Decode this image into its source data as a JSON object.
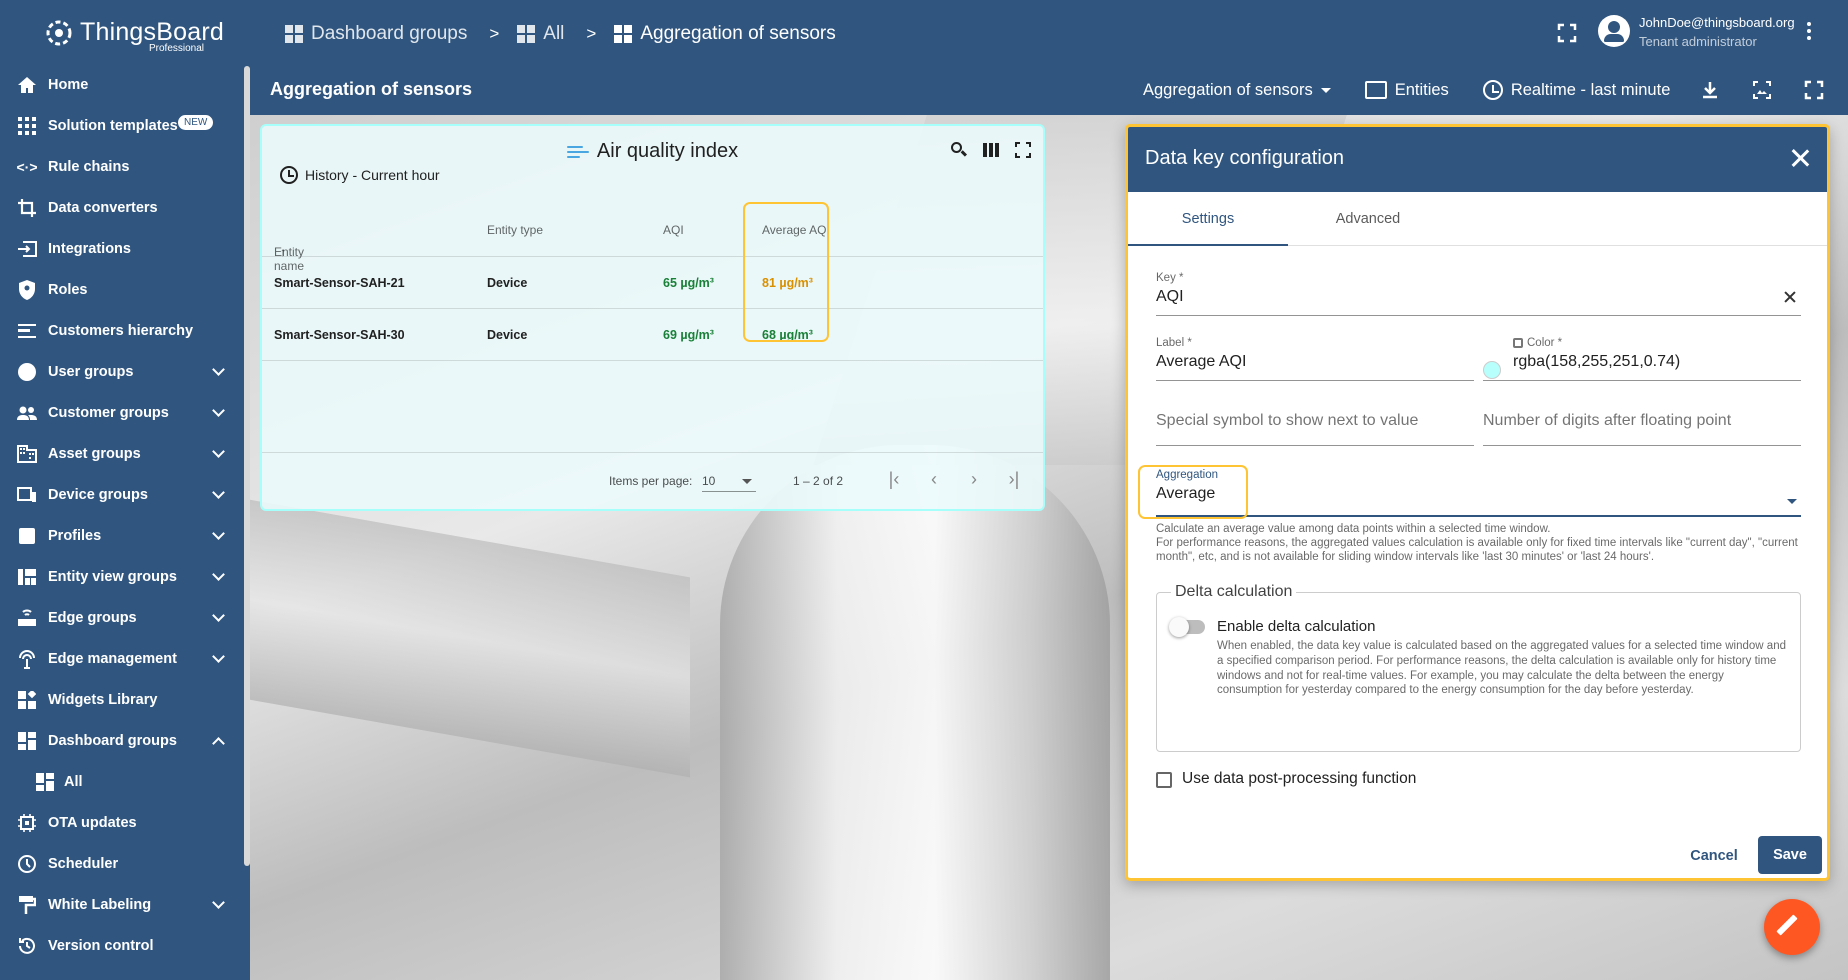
{
  "brand": {
    "name": "ThingsBoard",
    "edition": "Professional"
  },
  "breadcrumb": [
    {
      "label": "Dashboard groups"
    },
    {
      "label": "All"
    },
    {
      "label": "Aggregation of sensors"
    }
  ],
  "breadcrumb_sep": ">",
  "user": {
    "email": "JohnDoe@thingsboard.org",
    "role": "Tenant administrator"
  },
  "dashboard": {
    "title": "Aggregation of sensors",
    "state_selector": "Aggregation of sensors",
    "entities_label": "Entities",
    "timewindow": "Realtime - last minute"
  },
  "sidebar": {
    "items": [
      {
        "label": "Home",
        "icon": "home-icon"
      },
      {
        "label": "Solution templates",
        "icon": "apps-icon",
        "badge": "NEW"
      },
      {
        "label": "Rule chains",
        "icon": "code-arrows-icon"
      },
      {
        "label": "Data converters",
        "icon": "crop-icon"
      },
      {
        "label": "Integrations",
        "icon": "input-icon"
      },
      {
        "label": "Roles",
        "icon": "shield-icon"
      },
      {
        "label": "Customers hierarchy",
        "icon": "sort-lines-icon"
      },
      {
        "label": "User groups",
        "icon": "account-icon",
        "expandable": true
      },
      {
        "label": "Customer groups",
        "icon": "people-icon",
        "expandable": true
      },
      {
        "label": "Asset groups",
        "icon": "domain-icon",
        "expandable": true
      },
      {
        "label": "Device groups",
        "icon": "devices-icon",
        "expandable": true
      },
      {
        "label": "Profiles",
        "icon": "badge-icon",
        "expandable": true
      },
      {
        "label": "Entity view groups",
        "icon": "view-quilt-icon",
        "expandable": true
      },
      {
        "label": "Edge groups",
        "icon": "router-icon",
        "expandable": true
      },
      {
        "label": "Edge management",
        "icon": "settings-input-antenna-icon",
        "expandable": true
      },
      {
        "label": "Widgets Library",
        "icon": "widgets-icon"
      },
      {
        "label": "Dashboard groups",
        "icon": "dashboards-icon",
        "expandable": true,
        "expanded": true
      },
      {
        "label": "All",
        "icon": "dashboards-icon",
        "sub": true
      },
      {
        "label": "OTA updates",
        "icon": "memory-icon"
      },
      {
        "label": "Scheduler",
        "icon": "clock-icon"
      },
      {
        "label": "White Labeling",
        "icon": "format-paint-icon",
        "expandable": true
      },
      {
        "label": "Version control",
        "icon": "history-icon"
      }
    ]
  },
  "widget": {
    "title": "Air quality index",
    "history": "History - Current hour",
    "columns": [
      "Entity name",
      "Entity type",
      "AQI",
      "Average AQI"
    ],
    "rows": [
      {
        "name": "Smart-Sensor-SAH-21",
        "type": "Device",
        "aqi": "65 µg/m³",
        "avg": "81 µg/m³"
      },
      {
        "name": "Smart-Sensor-SAH-30",
        "type": "Device",
        "aqi": "69 µg/m³",
        "avg": "68 µg/m³"
      }
    ],
    "items_per_page_label": "Items per page:",
    "items_per_page": "10",
    "range": "1 – 2 of 2"
  },
  "dialog": {
    "title": "Data key configuration",
    "tabs": [
      "Settings",
      "Advanced"
    ],
    "key_label": "Key *",
    "key_value": "AQI",
    "label_label": "Label *",
    "label_value": "Average AQI",
    "color_label": "Color *",
    "color_value": "rgba(158,255,251,0.74)",
    "units_placeholder": "Special symbol to show next to value",
    "decimals_placeholder": "Number of digits after floating point",
    "aggregation_label": "Aggregation",
    "aggregation_value": "Average",
    "aggregation_hint_1": "Calculate an average value among data points within a selected time window.",
    "aggregation_hint_2": "For performance reasons, the aggregated values calculation is available only for fixed time intervals like \"current day\", \"current month\", etc, and is not available for sliding window intervals like 'last 30 minutes' or 'last 24 hours'.",
    "delta_legend": "Delta calculation",
    "delta_toggle": "Enable delta calculation",
    "delta_desc": "When enabled, the data key value is calculated based on the aggregated values for a selected time window and a specified comparison period. For performance reasons, the delta calculation is available only for history time windows and not for real-time values. For example, you may calculate the delta between the energy consumption for yesterday compared to the energy consumption for the day before yesterday.",
    "postprocessing": "Use data post-processing function",
    "cancel": "Cancel",
    "save": "Save"
  },
  "colors": {
    "primary": "#305680",
    "highlight": "#ffc433",
    "value_green": "#198038",
    "value_orange": "#d99000",
    "fab": "#ff5722"
  }
}
